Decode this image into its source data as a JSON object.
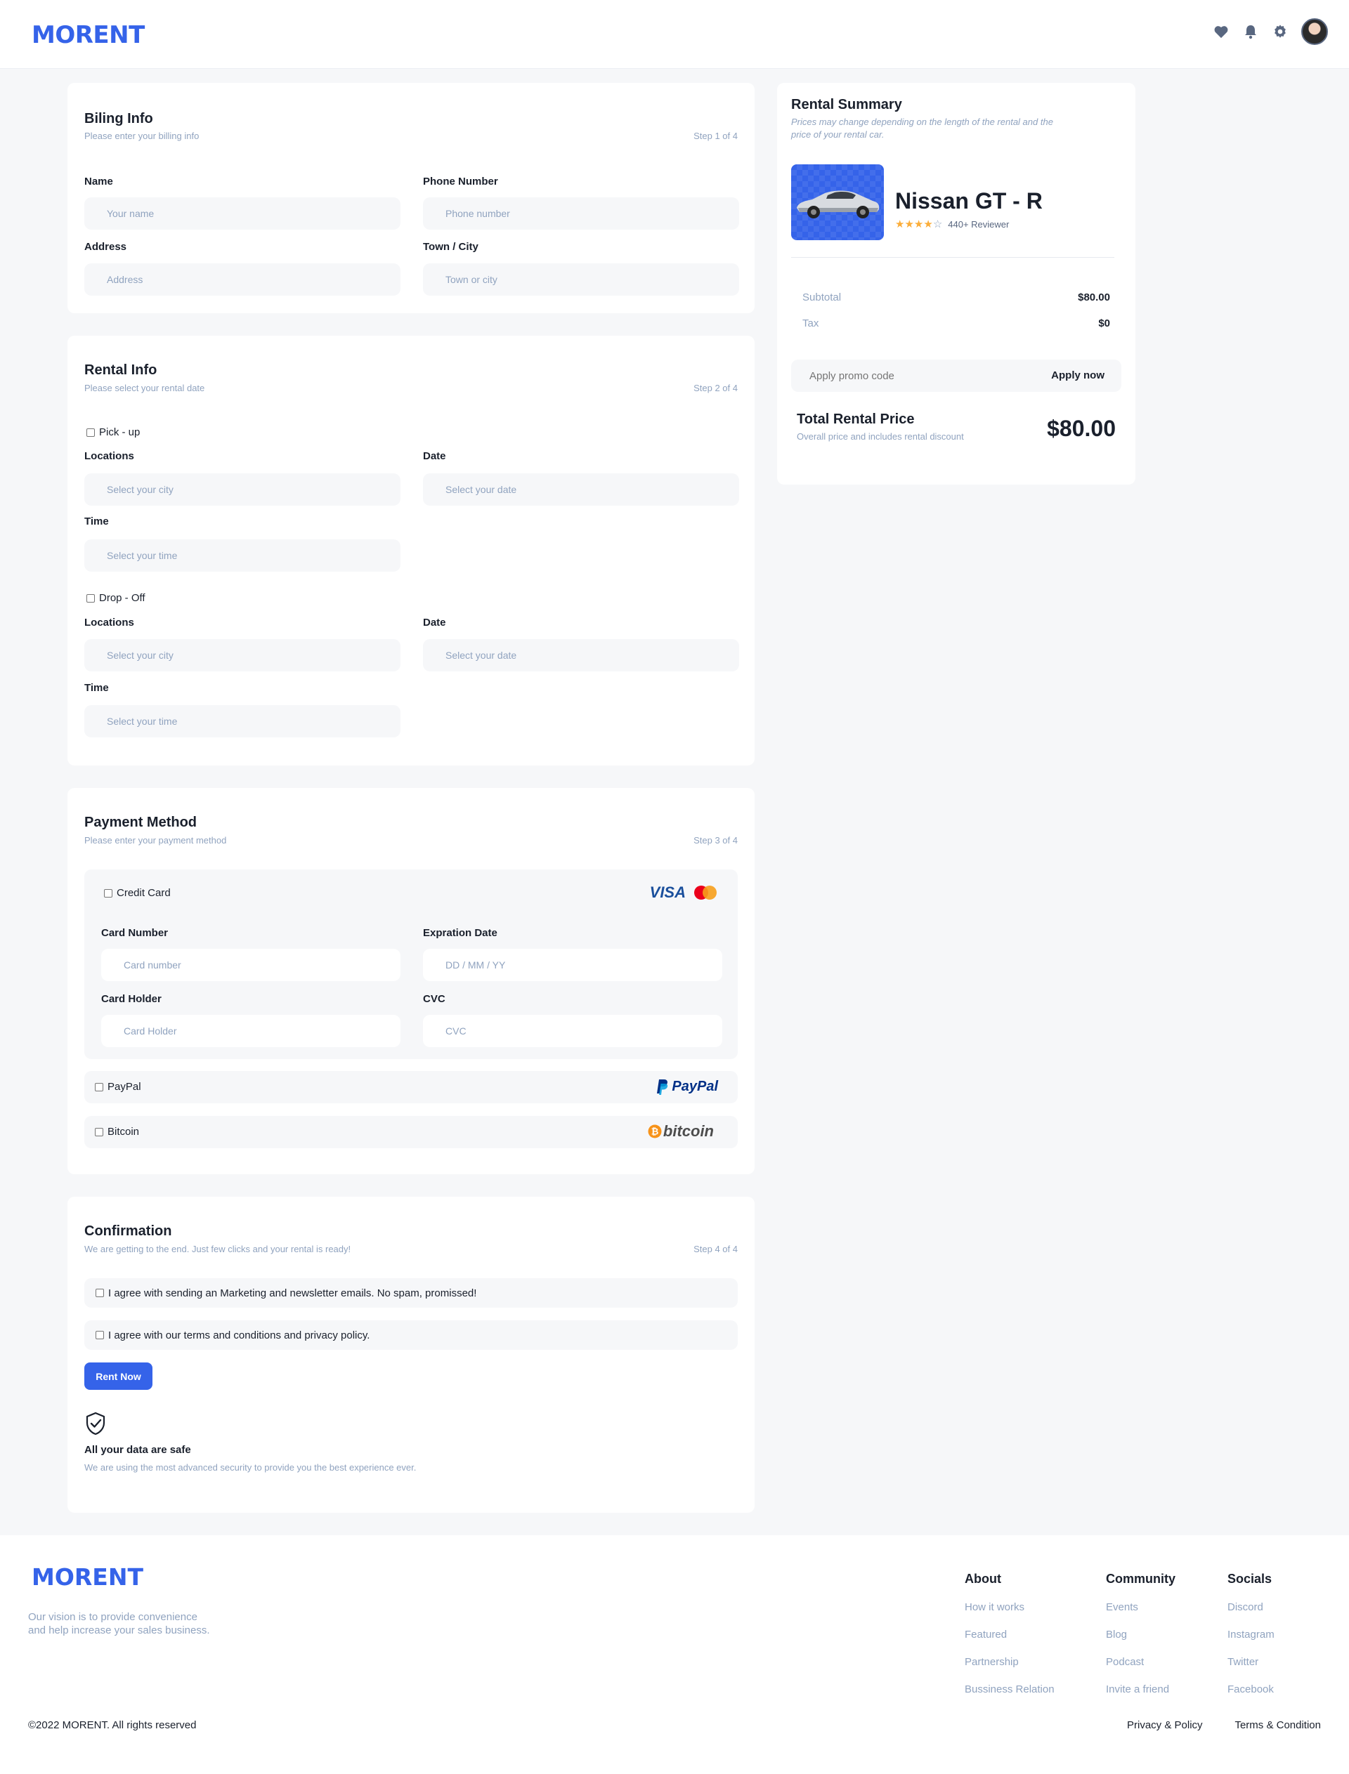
{
  "brand": "MORENT",
  "billing": {
    "title": "Biling Info",
    "subtitle": "Please enter your billing info",
    "step": "Step 1 of 4",
    "name_label": "Name",
    "name_placeholder": "Your name",
    "phone_label": "Phone Number",
    "phone_placeholder": "Phone number",
    "address_label": "Address",
    "address_placeholder": "Address",
    "city_label": "Town / City",
    "city_placeholder": "Town or city"
  },
  "rental": {
    "title": "Rental Info",
    "subtitle": "Please select your rental date",
    "step": "Step 2 of 4",
    "pickup_label": "Pick - up",
    "dropoff_label": "Drop - Off",
    "locations_label": "Locations",
    "date_label": "Date",
    "time_label": "Time",
    "city_placeholder": "Select your city",
    "date_placeholder": "Select your date",
    "time_placeholder": "Select your time"
  },
  "payment": {
    "title": "Payment Method",
    "subtitle": "Please enter your payment method",
    "step": "Step 3 of 4",
    "credit_card_label": "Credit Card",
    "visa_text": "VISA",
    "card_number_label": "Card Number",
    "card_number_placeholder": "Card number",
    "expiration_label": "Expration Date",
    "expiration_placeholder": "DD / MM / YY",
    "holder_label": "Card Holder",
    "holder_placeholder": "Card Holder",
    "cvc_label": "CVC",
    "cvc_placeholder": "CVC",
    "paypal_label": "PayPal",
    "paypal_logo": "PayPal",
    "bitcoin_label": "Bitcoin",
    "bitcoin_logo": "bitcoin"
  },
  "confirmation": {
    "title": "Confirmation",
    "subtitle": "We are getting to the end. Just few clicks and your rental is ready!",
    "step": "Step 4 of 4",
    "agree_marketing": "I agree with sending an Marketing and newsletter emails. No spam, promissed!",
    "agree_terms": "I agree with our terms and conditions and privacy policy.",
    "rent_button": "Rent Now",
    "safe_title": "All your data are safe",
    "safe_sub": "We are using the most advanced security to provide you the best experience ever."
  },
  "summary": {
    "title": "Rental Summary",
    "subtitle_line1": "Prices may change depending on the length of the rental and the",
    "subtitle_line2": "price of your rental car.",
    "car_name": "Nissan GT - R",
    "rating": 4,
    "reviewers": "440+ Reviewer",
    "subtotal_label": "Subtotal",
    "subtotal_value": "$80.00",
    "tax_label": "Tax",
    "tax_value": "$0",
    "promo_placeholder": "Apply promo code",
    "apply_label": "Apply now",
    "total_label": "Total Rental Price",
    "total_sub": "Overall price and includes rental discount",
    "total_value": "$80.00"
  },
  "footer": {
    "brand": "MORENT",
    "vision_line1": "Our vision is to provide convenience",
    "vision_line2": "and help increase your sales business.",
    "about": {
      "title": "About",
      "links": [
        "How it works",
        "Featured",
        "Partnership",
        "Bussiness Relation"
      ]
    },
    "community": {
      "title": "Community",
      "links": [
        "Events",
        "Blog",
        "Podcast",
        "Invite a friend"
      ]
    },
    "socials": {
      "title": "Socials",
      "links": [
        "Discord",
        "Instagram",
        "Twitter",
        "Facebook"
      ]
    },
    "copyright": "©2022 MORENT. All rights reserved",
    "privacy": "Privacy & Policy",
    "terms": "Terms & Condition"
  },
  "colors": {
    "primary": "#3563e9",
    "muted": "#90a3bf",
    "star": "#fbad39"
  }
}
